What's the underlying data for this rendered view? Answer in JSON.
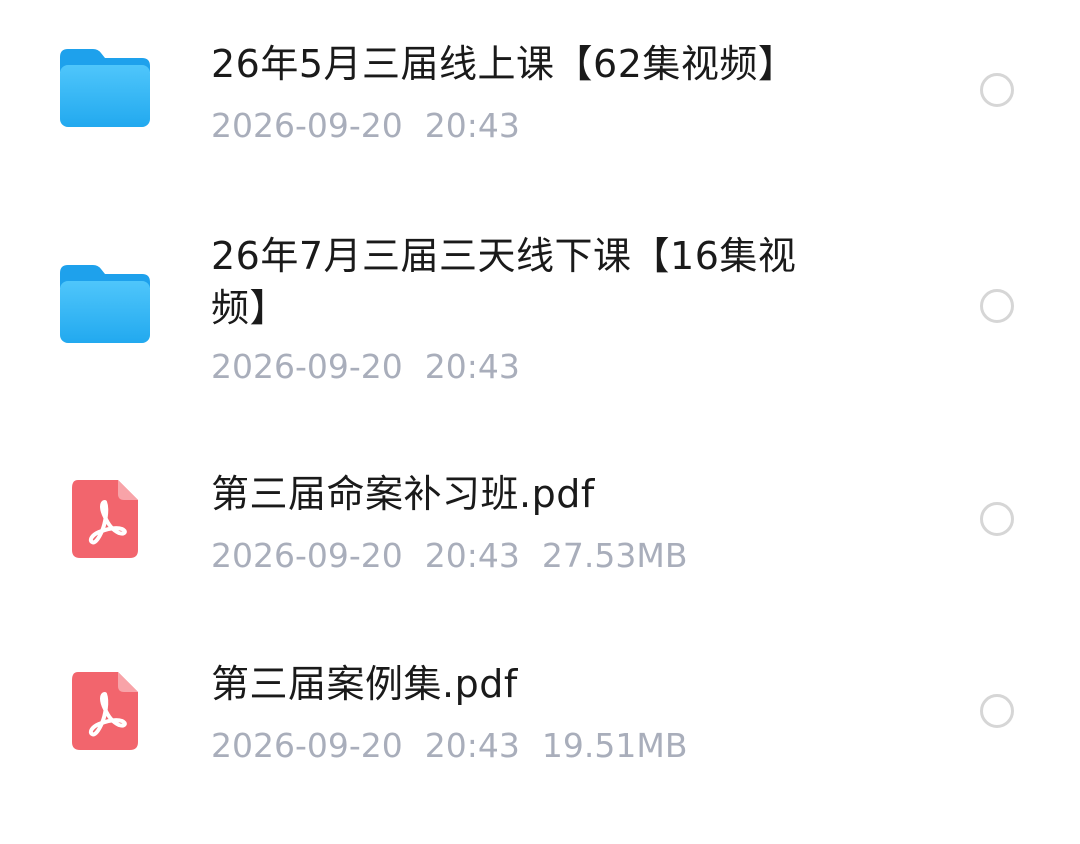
{
  "files": [
    {
      "icon": "folder-icon",
      "name": "26年5月三届线上课【62集视频】",
      "date": "2026-09-20",
      "time": "20:43",
      "size": ""
    },
    {
      "icon": "folder-icon",
      "name": "26年7月三届三天线下课【16集视频】",
      "date": "2026-09-20",
      "time": "20:43",
      "size": ""
    },
    {
      "icon": "pdf-icon",
      "name": "第三届命案补习班.pdf",
      "date": "2026-09-20",
      "time": "20:43",
      "size": "27.53MB"
    },
    {
      "icon": "pdf-icon",
      "name": "第三届案例集.pdf",
      "date": "2026-09-20",
      "time": "20:43",
      "size": "19.51MB"
    }
  ],
  "colors": {
    "folder": "#35b8f5",
    "pdf": "#f2656d",
    "title_text": "#1a1a1a",
    "meta_text": "#a9aebb",
    "circle_border": "#d6d6d6"
  }
}
